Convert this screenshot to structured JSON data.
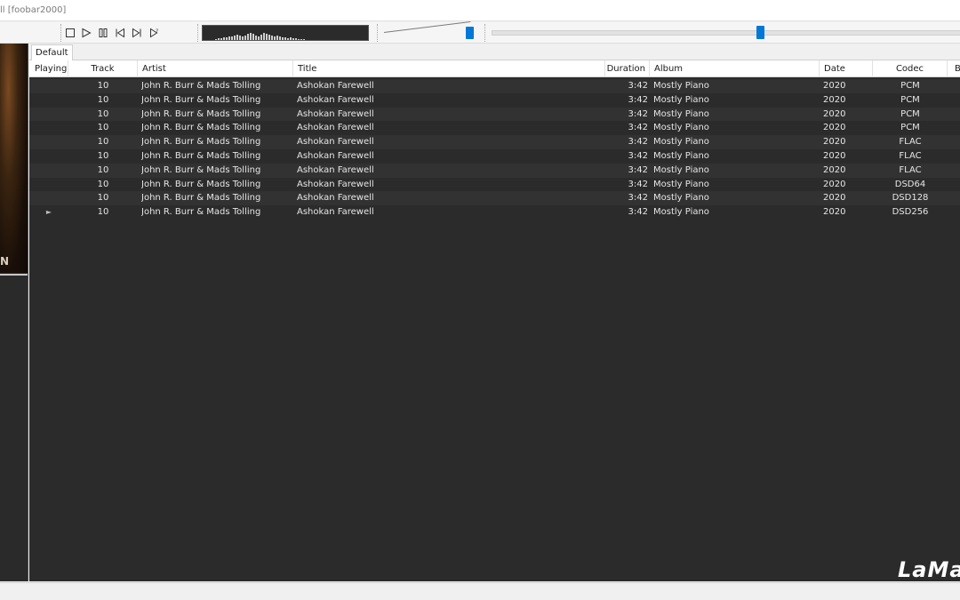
{
  "window": {
    "title": "ll  [foobar2000]"
  },
  "toolbar": {
    "icons": [
      "stop-icon",
      "play-icon",
      "pause-icon",
      "previous-icon",
      "next-icon",
      "random-icon"
    ],
    "accent": "#0078d7",
    "volume_level": 0.97,
    "seek_position": 0.56
  },
  "album_art": {
    "visible_letter": "N"
  },
  "playlist": {
    "tab": "Default",
    "columns": [
      "Playing",
      "Track",
      "Artist",
      "Title",
      "Duration",
      "Album",
      "Date",
      "Codec",
      "B"
    ],
    "rows": [
      {
        "playing": "",
        "track": "10",
        "artist": "John R. Burr & Mads Tolling",
        "title": "Ashokan Farewell",
        "duration": "3:42",
        "album": "Mostly Piano",
        "date": "2020",
        "codec": "PCM"
      },
      {
        "playing": "",
        "track": "10",
        "artist": "John R. Burr & Mads Tolling",
        "title": "Ashokan Farewell",
        "duration": "3:42",
        "album": "Mostly Piano",
        "date": "2020",
        "codec": "PCM"
      },
      {
        "playing": "",
        "track": "10",
        "artist": "John R. Burr & Mads Tolling",
        "title": "Ashokan Farewell",
        "duration": "3:42",
        "album": "Mostly Piano",
        "date": "2020",
        "codec": "PCM"
      },
      {
        "playing": "",
        "track": "10",
        "artist": "John R. Burr & Mads Tolling",
        "title": "Ashokan Farewell",
        "duration": "3:42",
        "album": "Mostly Piano",
        "date": "2020",
        "codec": "PCM"
      },
      {
        "playing": "",
        "track": "10",
        "artist": "John R. Burr & Mads Tolling",
        "title": "Ashokan Farewell",
        "duration": "3:42",
        "album": "Mostly Piano",
        "date": "2020",
        "codec": "FLAC"
      },
      {
        "playing": "",
        "track": "10",
        "artist": "John R. Burr & Mads Tolling",
        "title": "Ashokan Farewell",
        "duration": "3:42",
        "album": "Mostly Piano",
        "date": "2020",
        "codec": "FLAC"
      },
      {
        "playing": "",
        "track": "10",
        "artist": "John R. Burr & Mads Tolling",
        "title": "Ashokan Farewell",
        "duration": "3:42",
        "album": "Mostly Piano",
        "date": "2020",
        "codec": "FLAC"
      },
      {
        "playing": "",
        "track": "10",
        "artist": "John R. Burr & Mads Tolling",
        "title": "Ashokan Farewell",
        "duration": "3:42",
        "album": "Mostly Piano",
        "date": "2020",
        "codec": "DSD64"
      },
      {
        "playing": "",
        "track": "10",
        "artist": "John R. Burr & Mads Tolling",
        "title": "Ashokan Farewell",
        "duration": "3:42",
        "album": "Mostly Piano",
        "date": "2020",
        "codec": "DSD128"
      },
      {
        "playing": "►",
        "track": "10",
        "artist": "John R. Burr & Mads Tolling",
        "title": "Ashokan Farewell",
        "duration": "3:42",
        "album": "Mostly Piano",
        "date": "2020",
        "codec": "DSD256"
      }
    ]
  },
  "watermark": {
    "text": "LaMa"
  }
}
